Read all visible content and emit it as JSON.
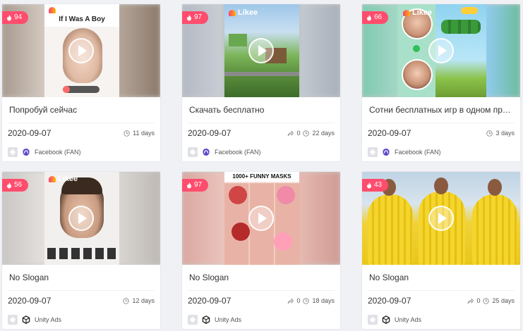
{
  "cards": [
    {
      "heat": "94",
      "overlay": "If I Was A Boy",
      "slogan": "Попробуй сейчас",
      "date": "2020-09-07",
      "shares": null,
      "days": "11 days",
      "network": "Facebook (FAN)"
    },
    {
      "heat": "97",
      "overlay": "Likee",
      "slogan": "Скачать бесплатно",
      "date": "2020-09-07",
      "shares": "0",
      "days": "22 days",
      "network": "Facebook (FAN)"
    },
    {
      "heat": "66",
      "overlay": "Likee",
      "slogan": "Сотни бесплатных игр в одном приложении",
      "date": "2020-09-07",
      "shares": null,
      "days": "3 days",
      "network": "Facebook (FAN)"
    },
    {
      "heat": "56",
      "overlay": "Likee",
      "slogan": "No Slogan",
      "date": "2020-09-07",
      "shares": null,
      "days": "12 days",
      "network": "Unity Ads"
    },
    {
      "heat": "97",
      "overlay": "1000+ FUNNY MASKS",
      "slogan": "No Slogan",
      "date": "2020-09-07",
      "shares": "0",
      "days": "18 days",
      "network": "Unity Ads"
    },
    {
      "heat": "43",
      "overlay": "",
      "slogan": "No Slogan",
      "date": "2020-09-07",
      "shares": "0",
      "days": "25 days",
      "network": "Unity Ads"
    }
  ],
  "icons": {
    "heat": "flame-icon",
    "play": "play-icon",
    "share": "share-icon",
    "clock": "clock-icon",
    "platform": "android-icon",
    "facebook_fan": "facebook-audience-network-icon",
    "unity": "unity-icon"
  },
  "colors": {
    "heat_badge": "#ff4d6d",
    "facebook_fan": "#5b4bcc",
    "unity": "#222222"
  }
}
